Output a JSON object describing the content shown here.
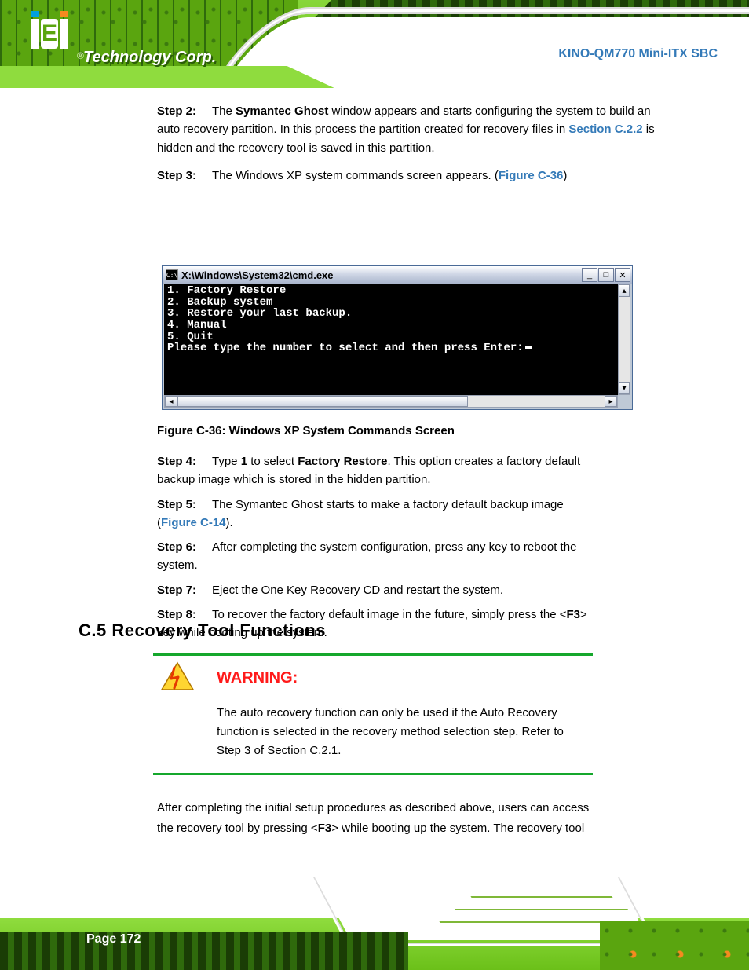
{
  "brand": {
    "reg": "®",
    "tagline": "Technology Corp."
  },
  "doc_title": "KINO-QM770 Mini-ITX SBC",
  "steps": [
    {
      "label": "Step 2:",
      "body_parts": [
        {
          "t": "The ",
          "b": false
        },
        {
          "t": "Symantec Ghost",
          "b": true
        },
        {
          "t": " window appears and starts configuring the system to build an auto recovery partition. In this process the partition created for recovery files in ",
          "b": false
        },
        {
          "t": "Section C.2.2",
          "xref": true
        },
        {
          "t": " is hidden and the recovery tool is saved in this partition.",
          "b": false
        }
      ]
    },
    {
      "label": "Step 3:",
      "body_parts": [
        {
          "t": "The Windows XP system commands screen appears. (",
          "b": false
        },
        {
          "t": "Figure C-36",
          "xref": true
        },
        {
          "t": ")",
          "b": false
        }
      ]
    }
  ],
  "cmd": {
    "title": "X:\\Windows\\System32\\cmd.exe",
    "icon_glyph": "C:\\",
    "lines": [
      "1. Factory Restore",
      "2. Backup system",
      "3. Restore your last backup.",
      "4. Manual",
      "5. Quit",
      "Please type the number to select and then press Enter:"
    ],
    "btn_min": "_",
    "btn_max": "□",
    "btn_close": "✕",
    "scroll_up": "▴",
    "scroll_down": "▾",
    "scroll_left": "◂",
    "scroll_right": "▸"
  },
  "figure_caption": "Figure C-36: Windows XP System Commands Screen",
  "step_list": [
    {
      "label": "Step 4:",
      "parts": [
        {
          "t": "Type ",
          "b": false
        },
        {
          "t": "1",
          "b": true
        },
        {
          "t": " to select ",
          "b": false
        },
        {
          "t": "Factory Restore",
          "b": true
        },
        {
          "t": ". This option creates a factory default backup image which is stored in the hidden partition.",
          "b": false
        }
      ]
    },
    {
      "label": "Step 5:",
      "parts": [
        {
          "t": "The Symantec Ghost starts to make a factory default backup image (",
          "b": false
        },
        {
          "t": "Figure C-14",
          "xref": true
        },
        {
          "t": ").",
          "b": false
        }
      ]
    },
    {
      "label": "Step 6:",
      "parts": [
        {
          "t": "After completing the system configuration, press any key to reboot the system.",
          "b": false
        }
      ]
    },
    {
      "label": "Step 7:",
      "parts": [
        {
          "t": "Eject the One Key Recovery CD and restart the system.",
          "b": false
        }
      ]
    },
    {
      "label": "Step 8:",
      "parts": [
        {
          "t": "To recover the factory default image in the future, simply press the <",
          "b": false
        },
        {
          "t": "F3",
          "b": true
        },
        {
          "t": "> key while booting up the system.",
          "b": false
        }
      ]
    }
  ],
  "section_heading": "C.5 Recovery Tool Functions",
  "warning": {
    "title": "WARNING:",
    "body": "The auto recovery function can only be used if the Auto Recovery  function is selected in the recovery method selection step. Refer to Step 3 of Section C.2.1."
  },
  "last_para_prefix": "After completing the initial setup procedures as described above, users can access the recovery tool by pressing <",
  "last_para_key": "F3",
  "last_para_suffix": "> while booting up the system. The recovery tool",
  "page_number": "Page 172"
}
